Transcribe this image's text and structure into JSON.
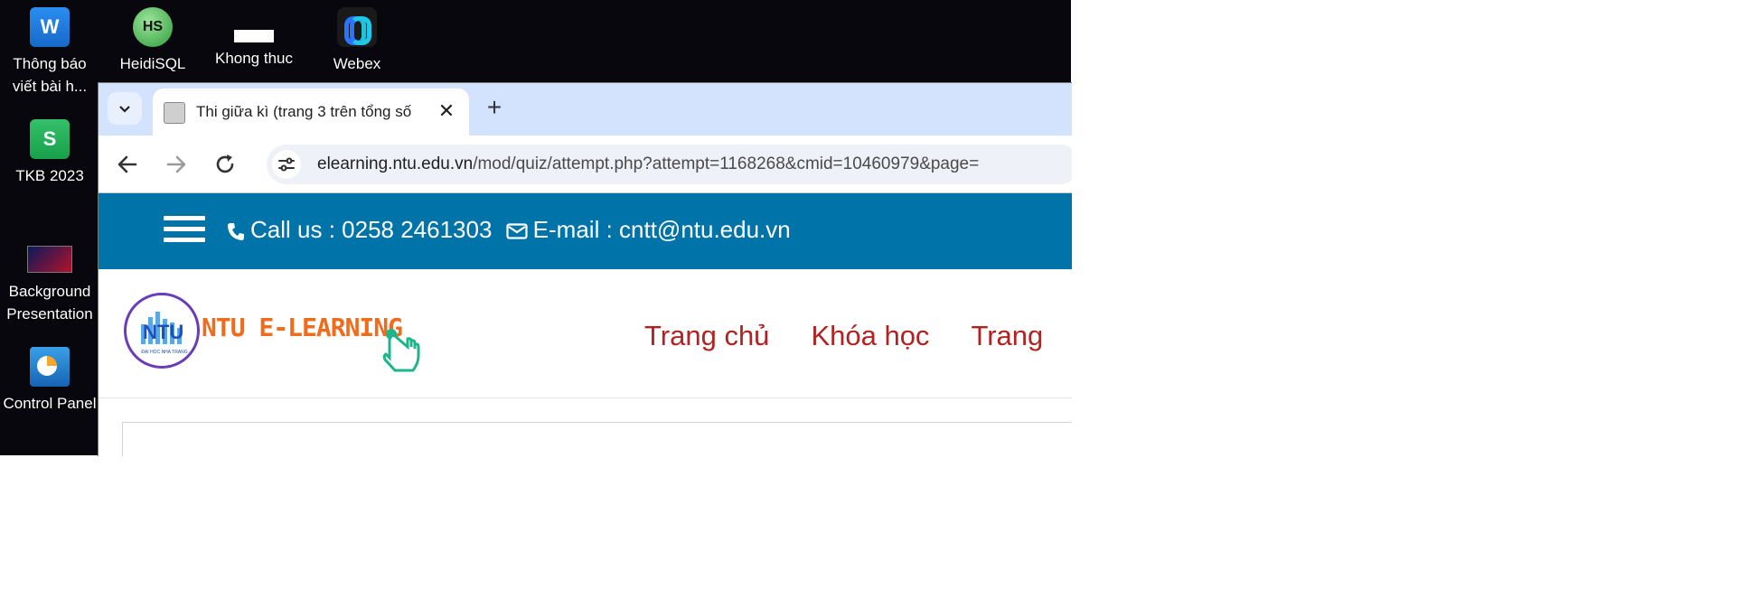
{
  "desktop": {
    "icons": [
      {
        "label": "Thông báo viết bài h...",
        "icon": "word-doc-icon"
      },
      {
        "label": "HeidiSQL",
        "icon": "heidisql-icon",
        "glyph": "HS"
      },
      {
        "label": "Khong thuc",
        "icon": "blank-file-icon"
      },
      {
        "label": "Webex",
        "icon": "webex-icon"
      },
      {
        "label": "TKB 2023",
        "icon": "spreadsheet-icon",
        "glyph": "S"
      },
      {
        "label": "Background Presentation",
        "icon": "presentation-thumbnail-icon"
      },
      {
        "label": "Control Panel",
        "icon": "control-panel-icon"
      }
    ]
  },
  "browser": {
    "tab": {
      "title": "Thi giữa kì (trang 3 trên tổng số"
    },
    "close_glyph": "✕",
    "new_tab_glyph": "+",
    "url": {
      "host": "elearning.ntu.edu.vn",
      "path": "/mod/quiz/attempt.php?attempt=1168268&cmid=10460979&page="
    }
  },
  "site": {
    "contact": {
      "phone": "Call us : 0258 2461303",
      "email": "E-mail : cntt@ntu.edu.vn"
    },
    "logo": {
      "short": "NTU",
      "brand": "NTU E-LEARNING",
      "sub": "ĐẠI HỌC NHA TRANG"
    },
    "nav": [
      "Trang chủ",
      "Khóa học",
      "Trang"
    ]
  },
  "colors": {
    "topbar": "#0073a8",
    "nav_link": "#b32222",
    "brand": "#ef6c1c",
    "tabbar": "#d3e3fd"
  }
}
